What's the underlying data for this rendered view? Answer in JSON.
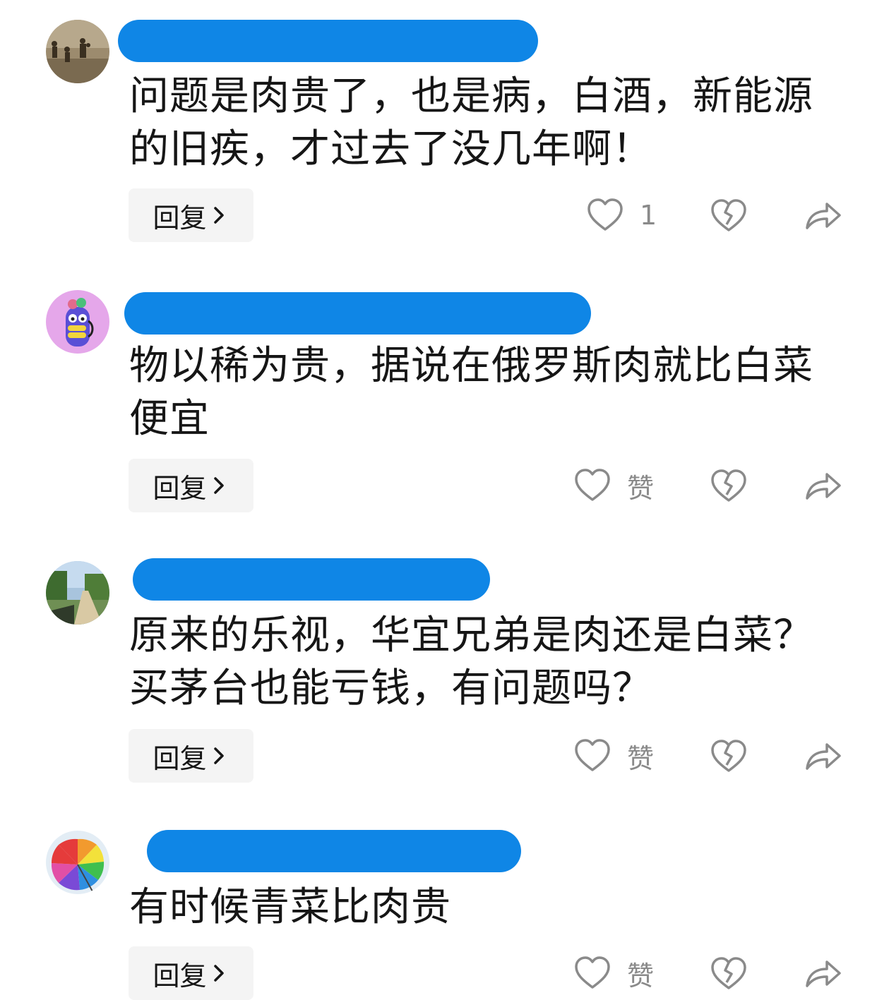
{
  "comments": [
    {
      "text": "问题是肉贵了，也是病，白酒，新能源的旧疾，才过去了没几年啊！",
      "reply_label": "回复",
      "like_label": "1"
    },
    {
      "text": "物以稀为贵，据说在俄罗斯肉就比白菜便宜",
      "reply_label": "回复",
      "like_label": "赞"
    },
    {
      "text": "原来的乐视，华宜兄弟是肉还是白菜？买茅台也能亏钱，有问题吗？",
      "reply_label": "回复",
      "like_label": "赞"
    },
    {
      "text": "有时候青菜比肉贵",
      "reply_label": "回复",
      "like_label": "赞"
    }
  ],
  "icons": {
    "like": "heart-outline-icon",
    "dislike": "broken-heart-icon",
    "share": "share-arrow-icon",
    "reply_chevron": "chevron-right-icon"
  },
  "colors": {
    "redaction": "#0f86e6",
    "text": "#161616",
    "icon": "#8a8a8a",
    "reply_bg": "#f4f4f4"
  }
}
